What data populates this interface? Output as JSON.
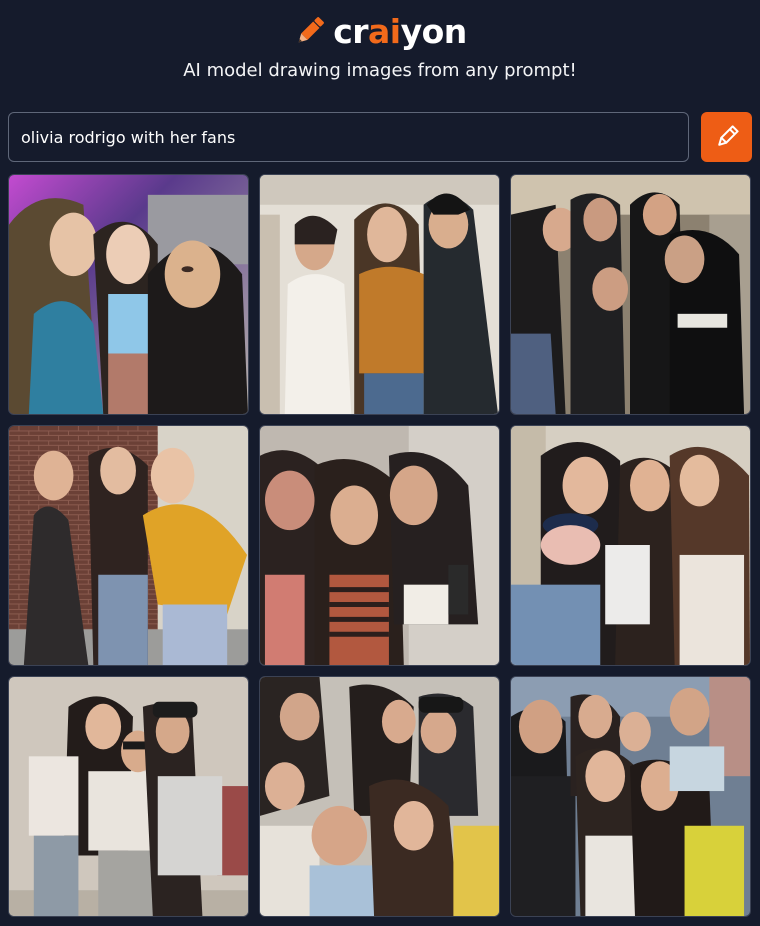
{
  "header": {
    "logo_text_pre": "cr",
    "logo_text_accent": "ai",
    "logo_text_post": "yon",
    "logo_icon": "pencil-icon",
    "tagline": "AI model drawing images from any prompt!"
  },
  "search": {
    "value": "olivia rodrigo with her fans",
    "button_icon": "pencil-icon"
  },
  "colors": {
    "background": "#151b2c",
    "accent": "#ee5d15",
    "input_border": "#5f6779"
  },
  "results": {
    "count_rows": 3,
    "count_cols": 3,
    "tiles": [
      {
        "id": 1
      },
      {
        "id": 2
      },
      {
        "id": 3
      },
      {
        "id": 4
      },
      {
        "id": 5
      },
      {
        "id": 6
      },
      {
        "id": 7
      },
      {
        "id": 8
      },
      {
        "id": 9
      }
    ]
  }
}
